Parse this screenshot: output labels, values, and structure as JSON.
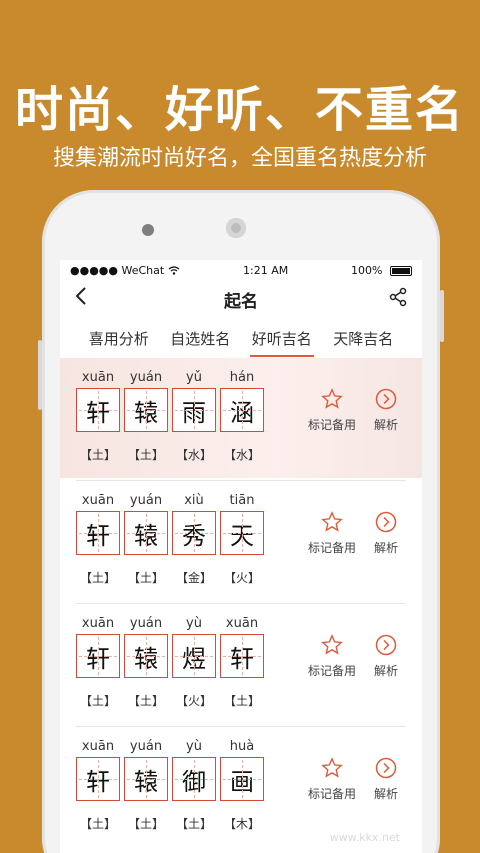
{
  "promo": {
    "headline": "时尚、好听、不重名",
    "subline": "搜集潮流时尚好名，全国重名热度分析"
  },
  "status_bar": {
    "carrier": "●●●●● WeChat",
    "time": "1:21 AM",
    "battery": "100%"
  },
  "navbar": {
    "title": "起名",
    "back_icon": "chevron-left-icon",
    "share_icon": "share-icon"
  },
  "tabs": [
    {
      "label": "喜用分析",
      "active": false
    },
    {
      "label": "自选姓名",
      "active": false
    },
    {
      "label": "好听吉名",
      "active": true
    },
    {
      "label": "天降吉名",
      "active": false
    }
  ],
  "actions": {
    "mark_label": "标记备用",
    "analyze_label": "解析"
  },
  "names": [
    {
      "chars": [
        {
          "pinyin": "xuān",
          "char": "轩",
          "element": "【土】"
        },
        {
          "pinyin": "yuán",
          "char": "辕",
          "element": "【土】"
        },
        {
          "pinyin": "yǔ",
          "char": "雨",
          "element": "【水】"
        },
        {
          "pinyin": "hán",
          "char": "涵",
          "element": "【水】"
        }
      ]
    },
    {
      "chars": [
        {
          "pinyin": "xuān",
          "char": "轩",
          "element": "【土】"
        },
        {
          "pinyin": "yuán",
          "char": "辕",
          "element": "【土】"
        },
        {
          "pinyin": "xiù",
          "char": "秀",
          "element": "【金】"
        },
        {
          "pinyin": "tiān",
          "char": "天",
          "element": "【火】"
        }
      ]
    },
    {
      "chars": [
        {
          "pinyin": "xuān",
          "char": "轩",
          "element": "【土】"
        },
        {
          "pinyin": "yuán",
          "char": "辕",
          "element": "【土】"
        },
        {
          "pinyin": "yù",
          "char": "煜",
          "element": "【火】"
        },
        {
          "pinyin": "xuān",
          "char": "轩",
          "element": "【土】"
        }
      ]
    },
    {
      "chars": [
        {
          "pinyin": "xuān",
          "char": "轩",
          "element": "【土】"
        },
        {
          "pinyin": "yuán",
          "char": "辕",
          "element": "【土】"
        },
        {
          "pinyin": "yù",
          "char": "御",
          "element": "【土】"
        },
        {
          "pinyin": "huà",
          "char": "画",
          "element": "【木】"
        }
      ]
    }
  ],
  "watermark": "www.kkx.net",
  "colors": {
    "background": "#C98A2E",
    "accent": "#E05A3A",
    "grid_border": "#D44A3A"
  }
}
